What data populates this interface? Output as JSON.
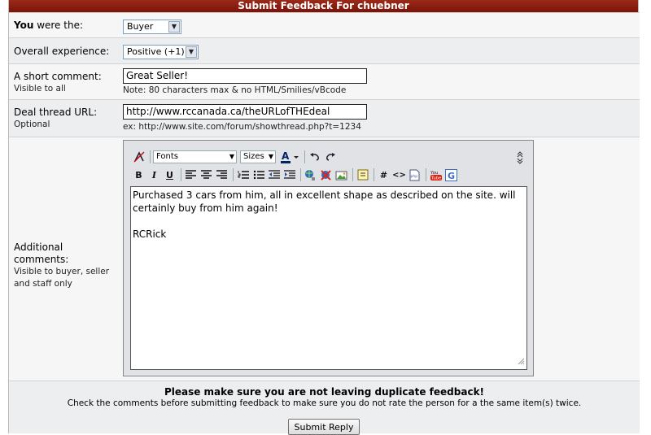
{
  "title": "Submit Feedback For chuebner",
  "role": {
    "label_bold": "You",
    "label_rest": " were the:",
    "selected": "Buyer"
  },
  "experience": {
    "label": "Overall experience:",
    "selected": "Positive (+1)"
  },
  "short_comment": {
    "label": "A short comment:",
    "sublabel": "Visible to all",
    "value": "Great Seller!",
    "note": "Note: 80 characters max & no HTML/Smilies/vBcode"
  },
  "deal_url": {
    "label": "Deal thread URL:",
    "sublabel": "Optional",
    "value": "http://www.rccanada.ca/theURLofTHEdeal",
    "note": "ex: http://www.site.com/forum/showthread.php?t=1234"
  },
  "comments": {
    "label": "Additional comments:",
    "sublabel": "Visible to buyer, seller and staff only",
    "line1": "Purchased 3 cars from him, all in excellent shape as described on the site. will",
    "line2": "certainly buy from him again!",
    "line3": "RCRick"
  },
  "editor": {
    "fonts_label": "Fonts",
    "sizes_label": "Sizes"
  },
  "warning": {
    "title": "Please make sure you are not leaving duplicate feedback!",
    "body": "Check the comments before submitting feedback to make sure you do not rate the person for a the same item(s) twice."
  },
  "submit_label": "Submit Reply"
}
